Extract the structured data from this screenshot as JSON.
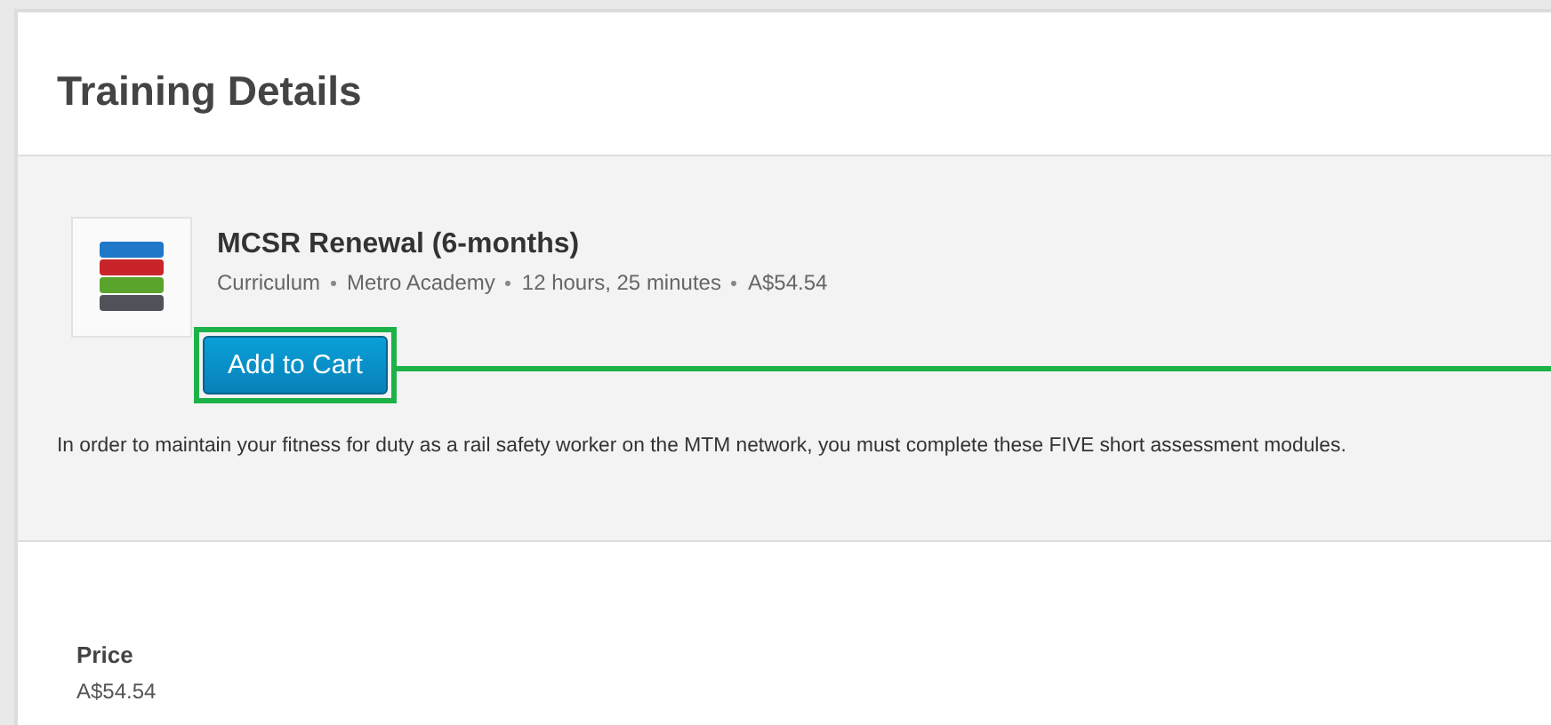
{
  "page": {
    "title": "Training Details"
  },
  "course": {
    "title": "MCSR Renewal (6-months)",
    "meta": [
      "Curriculum",
      "Metro Academy",
      "12 hours, 25 minutes",
      "A$54.54"
    ],
    "button": "Add to Cart",
    "highlighted": true,
    "description": "In order to maintain your fitness for duty as a rail safety worker on the MTM network, you must complete these FIVE short assessment modules."
  },
  "price": {
    "label": "Price",
    "value": "A$54.54"
  }
}
